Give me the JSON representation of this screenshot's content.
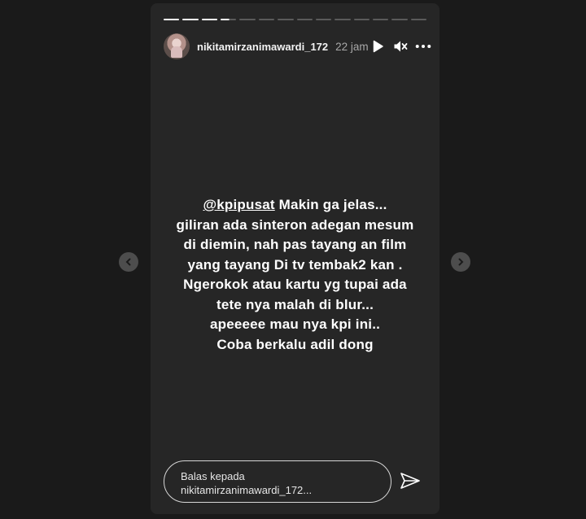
{
  "story": {
    "progress": {
      "total_segments": 14,
      "completed_segments": 3,
      "current_segment_fraction": 0.55
    },
    "header": {
      "username": "nikitamirzanimawardi_172",
      "time": "22 jam"
    },
    "content": {
      "mention": "@kpipusat",
      "lines": [
        " Makin ga jelas...",
        "giliran ada sinteron adegan mesum",
        "di diemin, nah pas tayang an film",
        "yang tayang Di tv tembak2 kan .",
        "Ngerokok atau kartu yg tupai ada",
        "tete nya malah di blur...",
        "apeeeee mau nya kpi ini..",
        "Coba berkalu adil dong"
      ]
    },
    "reply": {
      "line1": "Balas kepada",
      "line2": "nikitamirzanimawardi_172..."
    }
  },
  "icons": {
    "play": "play-icon",
    "mute": "speaker-muted-icon",
    "more": "more-options-icon",
    "send": "paper-plane-icon",
    "prev": "chevron-left-icon",
    "next": "chevron-right-icon"
  }
}
